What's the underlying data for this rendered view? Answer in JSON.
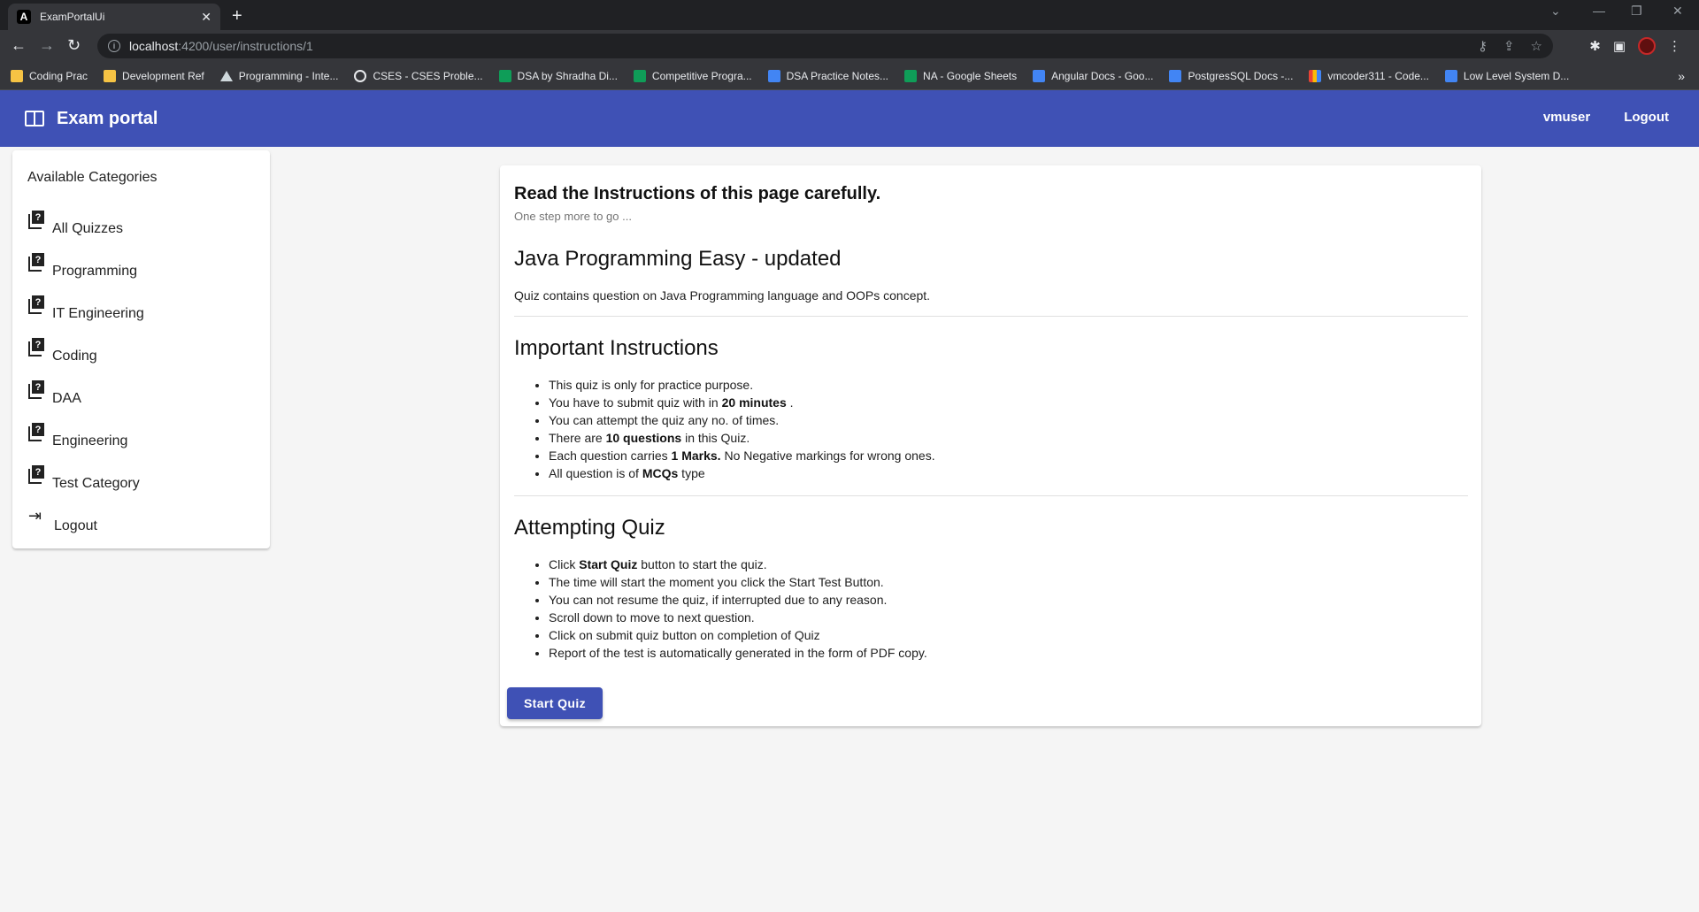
{
  "browser": {
    "tab_title": "ExamPortalUi",
    "tab_favicon": "A",
    "url_host": "localhost",
    "url_rest": ":4200/user/instructions/1",
    "bookmarks": [
      {
        "label": "Coding Prac",
        "icon": "folder"
      },
      {
        "label": "Development Ref",
        "icon": "folder"
      },
      {
        "label": "Programming - Inte...",
        "icon": "triangle"
      },
      {
        "label": "CSES - CSES Proble...",
        "icon": "globe"
      },
      {
        "label": "DSA by Shradha Di...",
        "icon": "sheet"
      },
      {
        "label": "Competitive Progra...",
        "icon": "sheet"
      },
      {
        "label": "DSA Practice Notes...",
        "icon": "doc"
      },
      {
        "label": "NA - Google Sheets",
        "icon": "sheet"
      },
      {
        "label": "Angular Docs - Goo...",
        "icon": "doc"
      },
      {
        "label": "PostgresSQL Docs -...",
        "icon": "doc"
      },
      {
        "label": "vmcoder311 - Code...",
        "icon": "bar"
      },
      {
        "label": "Low Level System D...",
        "icon": "doc"
      }
    ],
    "bookmarks_more": "»"
  },
  "app": {
    "title": "Exam portal",
    "user": "vmuser",
    "logout": "Logout",
    "accent": "#3f51b5"
  },
  "sidebar": {
    "header": "Available Categories",
    "items": [
      {
        "label": "All Quizzes"
      },
      {
        "label": "Programming"
      },
      {
        "label": "IT Engineering"
      },
      {
        "label": "Coding"
      },
      {
        "label": "DAA"
      },
      {
        "label": "Engineering"
      },
      {
        "label": "Test Category"
      }
    ],
    "logout": "Logout"
  },
  "main": {
    "title": "Read the Instructions of this page carefully.",
    "subtitle": "One step more to go ...",
    "quiz_title": "Java Programming Easy - updated",
    "quiz_description": "Quiz contains question on Java Programming language and OOPs concept.",
    "important_heading": "Important Instructions",
    "important": {
      "i1": "This quiz is only for practice purpose.",
      "i2_pre": "You have to submit quiz with in ",
      "i2_bold": "20 minutes",
      "i2_post": " .",
      "i3": "You can attempt the quiz any no. of times.",
      "i4_pre": "There are ",
      "i4_bold": "10 questions",
      "i4_post": " in this Quiz.",
      "i5_pre": "Each question carries ",
      "i5_bold": "1 Marks.",
      "i5_post": " No Negative markings for wrong ones.",
      "i6_pre": "All question is of ",
      "i6_bold": "MCQs",
      "i6_post": " type"
    },
    "attempting_heading": "Attempting Quiz",
    "attempting": {
      "a1_pre": "Click ",
      "a1_bold": "Start Quiz",
      "a1_post": " button to start the quiz.",
      "a2": "The time will start the moment you click the Start Test Button.",
      "a3": "You can not resume the quiz, if interrupted due to any reason.",
      "a4": "Scroll down to move to next question.",
      "a5": "Click on submit quiz button on completion of Quiz",
      "a6": "Report of the test is automatically generated in the form of PDF copy."
    },
    "start_button": "Start Quiz"
  }
}
